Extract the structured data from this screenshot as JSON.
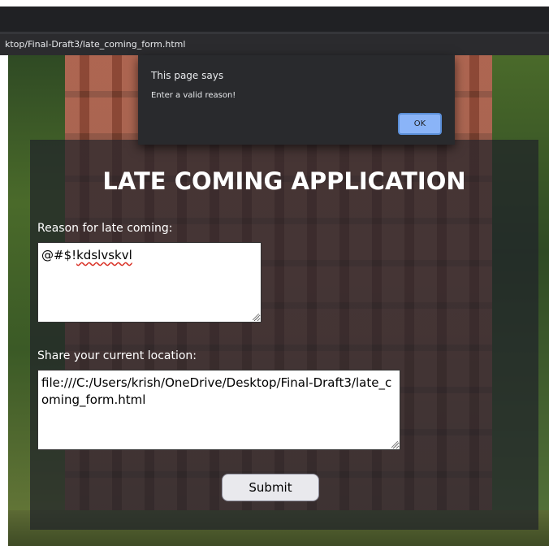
{
  "browser": {
    "address": "ktop/Final-Draft3/late_coming_form.html"
  },
  "form": {
    "title": "LATE COMING APPLICATION",
    "reason_label": "Reason for late coming:",
    "reason_value_plain": "@#$!",
    "reason_value_misspelled": "kdslvskvl",
    "location_label": "Share your current location:",
    "location_value": "file:///C:/Users/krish/OneDrive/Desktop/Final-Draft3/late_coming_form.html",
    "submit_label": "Submit"
  },
  "alert": {
    "title": "This page says",
    "message": "Enter a valid reason!",
    "ok_label": "OK"
  },
  "colors": {
    "chrome": "#202124",
    "dialog": "#292a2d",
    "ok_button": "#8ab4f8",
    "card_overlay": "rgba(32,34,42,0.72)"
  }
}
